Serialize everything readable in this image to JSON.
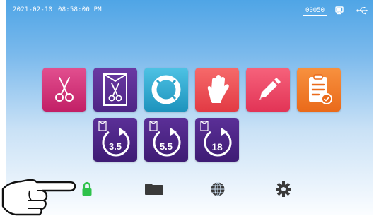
{
  "status": {
    "date": "2021-02-10",
    "time": "08:58:00 PM",
    "counter": "00050",
    "icons": [
      "screen-icon",
      "usb-icon"
    ]
  },
  "programs": [
    {
      "name": "scissors-program",
      "icon": "scissors-icon",
      "color": "#d9317a"
    },
    {
      "name": "pouched-scissors-program",
      "icon": "pouch-scissors-icon",
      "color": "#5e2d91"
    },
    {
      "name": "rubber-ring-program",
      "icon": "ring-icon",
      "color": "#2ca3c9"
    },
    {
      "name": "glove-program",
      "icon": "glove-icon",
      "color": "#ee4a4f"
    },
    {
      "name": "edit-program",
      "icon": "pencil-icon",
      "color": "#ef4567"
    },
    {
      "name": "checklist-program",
      "icon": "clipboard-check-icon",
      "color": "#f07a2b"
    }
  ],
  "cycles": [
    {
      "label": "3.5"
    },
    {
      "label": "5.5"
    },
    {
      "label": "18"
    }
  ],
  "bottom_bar": [
    "lock-icon",
    "folder-icon",
    "globe-icon",
    "gear-icon"
  ],
  "colors": {
    "accent_purple": "#4a2a8a",
    "lock_green": "#2ec24a"
  }
}
